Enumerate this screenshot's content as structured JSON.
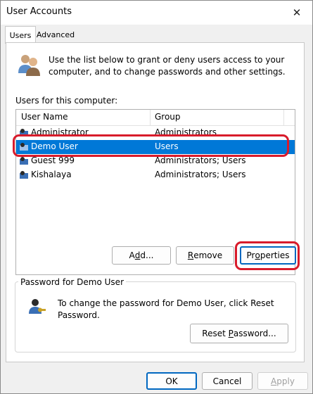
{
  "window": {
    "title": "User Accounts",
    "close_glyph": "✕",
    "close_icon": "close-icon"
  },
  "tabs": [
    {
      "label": "Users",
      "selected": true
    },
    {
      "label": "Advanced",
      "selected": false
    }
  ],
  "intro": {
    "icon": "users-icon",
    "text": "Use the list below to grant or deny users access to your computer, and to change passwords and other settings."
  },
  "user_list": {
    "label": "Users for this computer:",
    "columns": [
      "User Name",
      "Group"
    ],
    "rows": [
      {
        "name": "Administrator",
        "group": "Administrators",
        "selected": false
      },
      {
        "name": "Demo User",
        "group": "Users",
        "selected": true
      },
      {
        "name": "Guest 999",
        "group": "Administrators; Users",
        "selected": false
      },
      {
        "name": "Kishalaya",
        "group": "Administrators; Users",
        "selected": false
      }
    ],
    "selection_color": "#0078d7",
    "highlight_color": "#d81b2b"
  },
  "list_buttons": {
    "add_pre": "A",
    "add_mn": "d",
    "add_post": "d...",
    "remove_pre": "",
    "remove_mn": "R",
    "remove_post": "emove",
    "properties_pre": "Pr",
    "properties_mn": "o",
    "properties_post": "perties"
  },
  "password": {
    "group_label": "Password for Demo User",
    "text": "To change the password for Demo User, click Reset Password.",
    "reset_pre": "Reset ",
    "reset_mn": "P",
    "reset_post": "assword..."
  },
  "dialog_buttons": {
    "ok": "OK",
    "cancel": "Cancel",
    "apply_pre": "",
    "apply_mn": "A",
    "apply_post": "pply"
  }
}
